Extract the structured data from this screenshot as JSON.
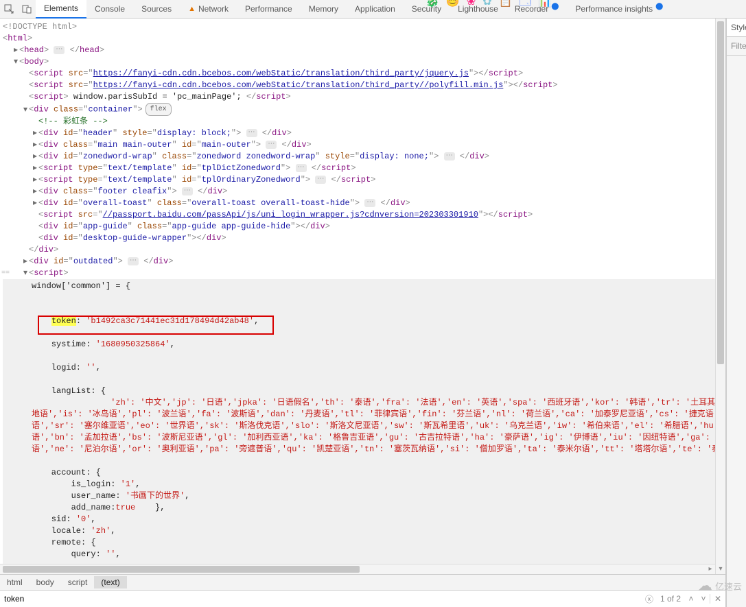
{
  "tabs": {
    "elements": "Elements",
    "console": "Console",
    "sources": "Sources",
    "network": "Network",
    "performance": "Performance",
    "memory": "Memory",
    "application": "Application",
    "security": "Security",
    "lighthouse": "Lighthouse",
    "recorder": "Recorder",
    "perf_insights": "Performance insights"
  },
  "side": {
    "styles": "Style",
    "filter": "Filte"
  },
  "crumbs": {
    "html": "html",
    "body": "body",
    "script": "script",
    "text": "(text)"
  },
  "search": {
    "value": "token",
    "count": "1 of 2"
  },
  "badge": {
    "flex": "flex"
  },
  "dom": {
    "doctype": "<!DOCTYPE html>",
    "html_open": "html",
    "head_open": "head",
    "head_close": "head",
    "body_open": "body",
    "s1_url": "https://fanyi-cdn.cdn.bcebos.com/webStatic/translation/third_party/jquery.js",
    "s2_url": "https://fanyi-cdn.cdn.bcebos.com/webStatic/translation/third_party//polyfill.min.js",
    "s3_code": " window.parisSubId = 'pc_mainPage'; ",
    "container_class": "container",
    "rainbow_comment": "<!-- 彩虹条 -->",
    "header_id": "header",
    "header_style": "display: block;",
    "main_class": "main main-outer",
    "main_id": "main-outer",
    "zoned_id": "zonedword-wrap",
    "zoned_class": "zonedword zonedword-wrap",
    "zoned_style": "display: none;",
    "tpl1_id": "tplDictZonedword",
    "tpl_type": "text/template",
    "tpl2_id": "tplOrdinaryZonedword",
    "footer_class": "footer cleafix",
    "toast_id": "overall-toast",
    "toast_class": "overall-toast overall-toast-hide",
    "passport_url": "//passport.baidu.com/passApi/js/uni_login_wrapper.js?cdnversion=202303301910",
    "appguide_id": "app-guide",
    "appguide_class": "app-guide app-guide-hide",
    "desktop_id": "desktop-guide-wrapper",
    "outdated_id": "outdated",
    "div": "div",
    "script": "script",
    "close_div": "div",
    "close_script": "script"
  },
  "code": {
    "l1": "window['common'] = {",
    "token_key": "token",
    "token_colon": ": ",
    "token_val": "'b1492ca3c71441ec31d178494d42ab48'",
    "comma": ",",
    "systime": "    systime: '1680950325864',",
    "logid": "    logid: '',",
    "langlist": "    langList: {",
    "langrow1": "                'zh': '中文','jp': '日语','jpka': '日语假名','th': '泰语','fra': '法语','en': '英语','spa': '西班牙语','kor': '韩语','tr': '土耳其语','vie'",
    "langrow2": "地语','is': '冰岛语','pl': '波兰语','fa': '波斯语','dan': '丹麦语','tl': '菲律宾语','fin': '芬兰语','nl': '荷兰语','ca': '加泰罗尼亚语','cs': '捷克语','hr':",
    "langrow3": "语','sr': '塞尔维亚语','eo': '世界语','sk': '斯洛伐克语','slo': '斯洛文尼亚语','sw': '斯瓦希里语','uk': '乌克兰语','iw': '希伯来语','el': '希腊语','hu': '匈牙",
    "langrow4": "语','bn': '孟加拉语','bs': '波斯尼亚语','gl': '加利西亚语','ka': '格鲁吉亚语','gu': '古吉拉特语','ha': '豪萨语','ig': '伊博语','iu': '因纽特语','ga': '爱尔兰",
    "langrow5": "语','ne': '尼泊尔语','or': '奥利亚语','pa': '旁遮普语','qu': '凯楚亚语','tn': '塞茨瓦纳语','si': '僧加罗语','ta': '泰米尔语','tt': '塔塔尔语','te': '泰卢固语'",
    "account": "    account: {",
    "islogin": "        is_login: '1',",
    "username": "        user_name: '书画下的世界',",
    "addname": "        add_name:true    },",
    "sid": "    sid: '0',",
    "locale": "    locale: 'zh',",
    "remote": "    remote: {",
    "query": "        query: '',"
  },
  "watermark": {
    "text": "亿速云"
  }
}
